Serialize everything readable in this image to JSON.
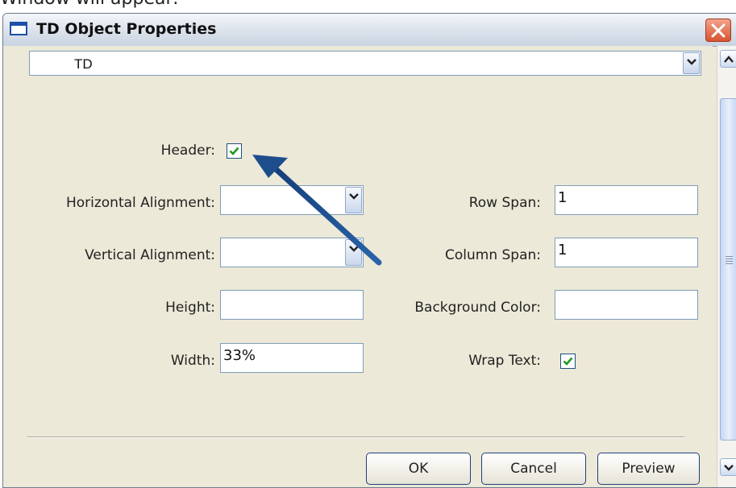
{
  "caption": "Window will appear:",
  "window": {
    "title": "TD Object Properties"
  },
  "element_select": {
    "value": "TD"
  },
  "fields": {
    "header": {
      "label": "Header:",
      "checked": true
    },
    "horizontal_alignment": {
      "label": "Horizontal Alignment:",
      "value": ""
    },
    "vertical_alignment": {
      "label": "Vertical Alignment:",
      "value": ""
    },
    "height": {
      "label": "Height:",
      "value": ""
    },
    "width": {
      "label": "Width:",
      "value": "33%"
    },
    "row_span": {
      "label": "Row Span:",
      "value": "1"
    },
    "column_span": {
      "label": "Column Span:",
      "value": "1"
    },
    "background_color": {
      "label": "Background Color:",
      "value": ""
    },
    "wrap_text": {
      "label": "Wrap Text:",
      "checked": true
    }
  },
  "buttons": {
    "ok": "OK",
    "cancel": "Cancel",
    "preview": "Preview"
  },
  "colors": {
    "check": "#1f9a1f",
    "arrow": "#1e4d8c"
  }
}
